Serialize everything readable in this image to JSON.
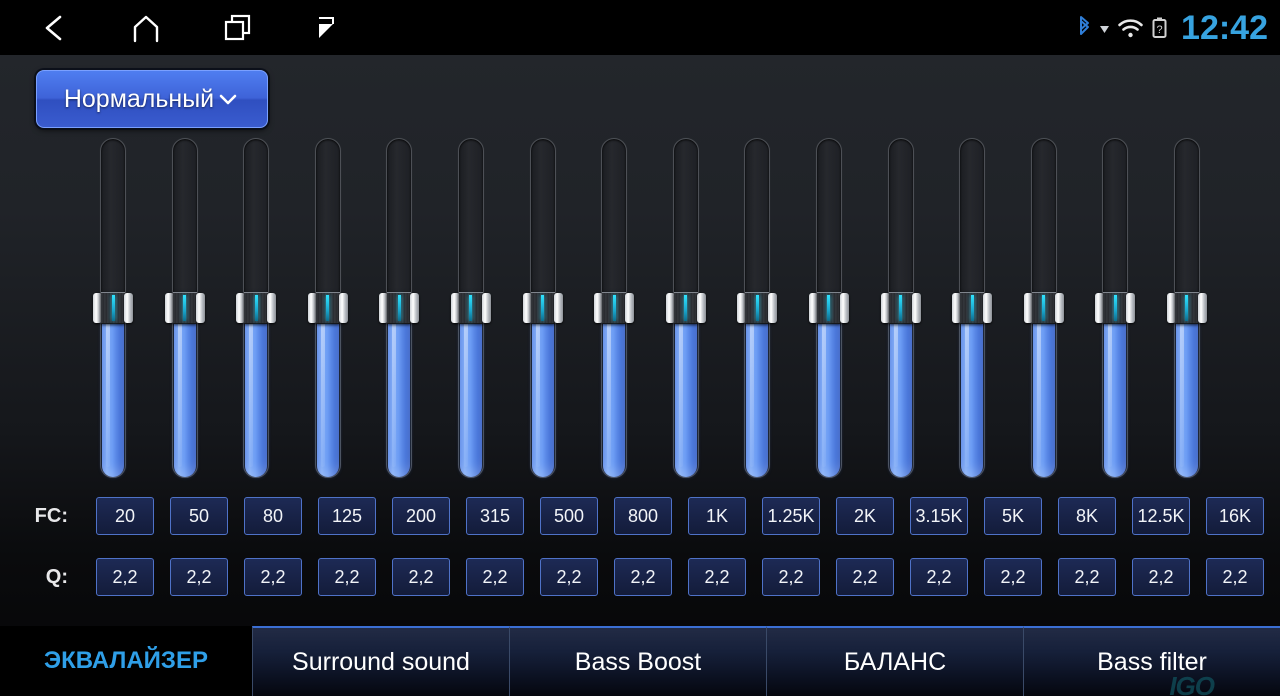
{
  "statusbar": {
    "nav": [
      {
        "name": "back-icon",
        "label": "Back"
      },
      {
        "name": "home-icon",
        "label": "Home"
      },
      {
        "name": "recent-apps-icon",
        "label": "Recent apps"
      },
      {
        "name": "flag-icon",
        "label": "Flag"
      }
    ],
    "icons": [
      {
        "name": "bluetooth-icon",
        "color": "#2f7ed8"
      },
      {
        "name": "signal-triangle-icon",
        "color": "#d8d8d8"
      },
      {
        "name": "wifi-icon",
        "color": "#e8e8e8"
      },
      {
        "name": "battery-unknown-icon",
        "color": "#d0d0d0",
        "glyph": "?"
      }
    ],
    "clock": "12:42"
  },
  "preset": {
    "label": "Нормальный",
    "chevron": "chevron-down-icon",
    "accent": "#3e63d8"
  },
  "equalizer": {
    "band_count": 16,
    "fc_label": "FC:",
    "q_label": "Q:",
    "fc_values": [
      "20",
      "50",
      "80",
      "125",
      "200",
      "315",
      "500",
      "800",
      "1K",
      "1.25K",
      "2K",
      "3.15K",
      "5K",
      "8K",
      "12.5K",
      "16K"
    ],
    "q_values": [
      "2,2",
      "2,2",
      "2,2",
      "2,2",
      "2,2",
      "2,2",
      "2,2",
      "2,2",
      "2,2",
      "2,2",
      "2,2",
      "2,2",
      "2,2",
      "2,2",
      "2,2",
      "2,2"
    ],
    "slider_percent": [
      50,
      50,
      50,
      50,
      50,
      50,
      50,
      50,
      50,
      50,
      50,
      50,
      50,
      50,
      50,
      50
    ],
    "fill_color": "#6c9cf4",
    "cell_border_color": "#4f72c8"
  },
  "tabs": [
    {
      "label": "ЭКВАЛАЙЗЕР",
      "active": true
    },
    {
      "label": "Surround sound",
      "active": false
    },
    {
      "label": "Bass Boost",
      "active": false
    },
    {
      "label": "БАЛАНС",
      "active": false
    },
    {
      "label": "Bass filter",
      "active": false
    }
  ],
  "watermark": "IGO"
}
